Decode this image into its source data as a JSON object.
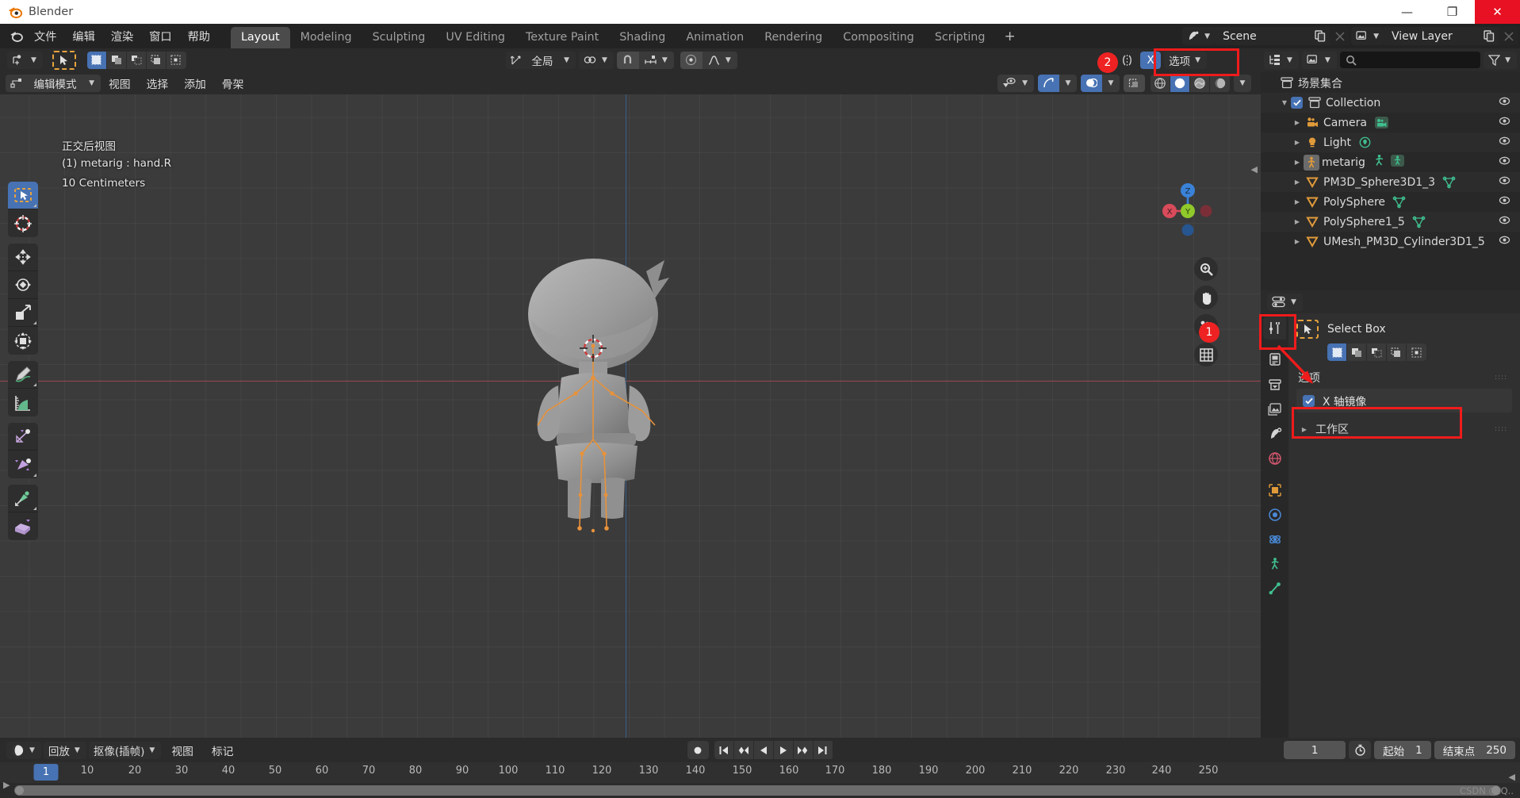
{
  "window": {
    "title": "Blender",
    "logo_icon": "blender-logo-icon",
    "minimize_label": "—",
    "maximize_label": "❐",
    "close_label": "✕"
  },
  "topbar": {
    "menus": [
      "文件",
      "编辑",
      "渲染",
      "窗口",
      "帮助"
    ],
    "workspaces": [
      {
        "label": "Layout",
        "active": true
      },
      {
        "label": "Modeling",
        "active": false
      },
      {
        "label": "Sculpting",
        "active": false
      },
      {
        "label": "UV Editing",
        "active": false
      },
      {
        "label": "Texture Paint",
        "active": false
      },
      {
        "label": "Shading",
        "active": false
      },
      {
        "label": "Animation",
        "active": false
      },
      {
        "label": "Rendering",
        "active": false
      },
      {
        "label": "Compositing",
        "active": false
      },
      {
        "label": "Scripting",
        "active": false
      }
    ],
    "add_workspace_label": "+",
    "scene_name": "Scene",
    "view_layer_name": "View Layer",
    "scene_icon": "scene-icon",
    "view_layer_icon": "view-layer-icon",
    "new_icon": "duplicate-icon",
    "unlink_icon": "x-icon"
  },
  "viewport": {
    "header": {
      "editor_type_icon": "editor-type-icon",
      "select_tool_icon": "select-box-tool-icon",
      "select_modes": [
        "new",
        "extend",
        "subtract",
        "invert",
        "intersect"
      ],
      "select_mode_active": 0,
      "transform_orientation": "全局",
      "pivot_icon": "pivot-point-icon",
      "snap_icon": "snap-magnet-icon",
      "snap_target_icon": "snap-increment-icon",
      "proportional_icon": "proportional-edit-icon",
      "falloff_icon": "falloff-smooth-icon",
      "xray_icon": "x-ray-toggle-icon",
      "mirror_x_label": "X",
      "options_label": "选项"
    },
    "subheader": {
      "mode_icon": "edit-mode-icon",
      "mode": "编辑模式",
      "menus": [
        "视图",
        "选择",
        "添加",
        "骨架"
      ],
      "visibility_icon": "show-hide-icon",
      "gizmo_icon": "gizmo-icon",
      "overlays_icon": "overlays-icon",
      "xray_btn_icon": "toggle-xray-icon",
      "shading_modes": [
        "wireframe",
        "solid",
        "material",
        "rendered"
      ],
      "shading_active": 1
    },
    "overlay_text": [
      "正交后视图",
      "(1) metarig : hand.R",
      "10 Centimeters"
    ],
    "toolbar": [
      {
        "icon": "select-box-tool-icon",
        "active": true,
        "group": 0
      },
      {
        "icon": "cursor-tool-icon",
        "active": false,
        "group": 0
      },
      {
        "icon": "move-tool-icon",
        "active": false,
        "group": 1
      },
      {
        "icon": "rotate-tool-icon",
        "active": false,
        "group": 1
      },
      {
        "icon": "scale-tool-icon",
        "active": false,
        "group": 1
      },
      {
        "icon": "transform-tool-icon",
        "active": false,
        "group": 1
      },
      {
        "icon": "annotate-tool-icon",
        "active": false,
        "group": 2
      },
      {
        "icon": "measure-tool-icon",
        "active": false,
        "group": 2
      },
      {
        "icon": "bone-roll-tool-icon",
        "active": false,
        "group": 3
      },
      {
        "icon": "bone-size-tool-icon",
        "active": false,
        "group": 3
      },
      {
        "icon": "extrude-bone-tool-icon",
        "active": false,
        "group": 4
      },
      {
        "icon": "extrude-region-tool-icon",
        "active": false,
        "group": 4
      }
    ],
    "gizmo": {
      "axes": [
        {
          "label": "Z",
          "color": "#3a82d8",
          "pos": "top"
        },
        {
          "label": "X",
          "color": "#e04b5a",
          "pos": "left"
        },
        {
          "label": "Y",
          "color": "#8fc92a",
          "pos": "center"
        }
      ]
    },
    "nav_buttons": [
      "zoom-icon",
      "pan-hand-icon",
      "camera-view-icon",
      "toggle-ortho-grid-icon"
    ]
  },
  "outliner": {
    "display_mode_icon": "outliner-display-mode-icon",
    "filter_id_icon": "filter-id-icon",
    "search_icon": "search-icon",
    "search_placeholder": "",
    "filter_icon": "funnel-filter-icon",
    "root_label": "场景集合",
    "root_icon": "scene-collection-icon",
    "items": [
      {
        "label": "Collection",
        "icon": "collection-icon",
        "indent": 1,
        "checkbox": true,
        "expanded": true,
        "tags": []
      },
      {
        "label": "Camera",
        "icon": "camera-object-icon",
        "indent": 2,
        "checkbox": false,
        "expanded": false,
        "tags": [
          "camera-data-icon"
        ]
      },
      {
        "label": "Light",
        "icon": "light-object-icon",
        "indent": 2,
        "checkbox": false,
        "expanded": false,
        "tags": [
          "light-data-icon"
        ]
      },
      {
        "label": "metarig",
        "icon": "armature-object-icon",
        "indent": 2,
        "checkbox": false,
        "expanded": false,
        "tags": [
          "pose-icon",
          "armature-data-icon"
        ]
      },
      {
        "label": "PM3D_Sphere3D1_3",
        "icon": "mesh-object-icon",
        "indent": 2,
        "checkbox": false,
        "expanded": false,
        "tags": [
          "mesh-data-icon"
        ]
      },
      {
        "label": "PolySphere",
        "icon": "mesh-object-icon",
        "indent": 2,
        "checkbox": false,
        "expanded": false,
        "tags": [
          "mesh-data-icon"
        ]
      },
      {
        "label": "PolySphere1_5",
        "icon": "mesh-object-icon",
        "indent": 2,
        "checkbox": false,
        "expanded": false,
        "tags": [
          "mesh-data-icon"
        ]
      },
      {
        "label": "UMesh_PM3D_Cylinder3D1_5",
        "icon": "mesh-object-icon",
        "indent": 2,
        "checkbox": false,
        "expanded": false,
        "tags": []
      }
    ],
    "visibility_icon": "eye-icon"
  },
  "properties": {
    "editor_icon": "properties-editor-icon",
    "tabs": [
      {
        "icon": "tool-icon",
        "name": "tool",
        "active": true
      },
      {
        "icon": "render-icon",
        "name": "render",
        "active": false
      },
      {
        "icon": "output-icon",
        "name": "output",
        "active": false
      },
      {
        "icon": "view-layer-props-icon",
        "name": "view-layer",
        "active": false
      },
      {
        "icon": "scene-props-icon",
        "name": "scene",
        "active": false
      },
      {
        "icon": "world-icon",
        "name": "world",
        "active": false
      },
      {
        "icon": "object-props-icon",
        "name": "object",
        "active": false
      },
      {
        "icon": "modifier-icon",
        "name": "modifiers",
        "active": false
      },
      {
        "icon": "physics-icon",
        "name": "physics",
        "active": false
      },
      {
        "icon": "object-constraints-icon",
        "name": "constraints",
        "active": false
      },
      {
        "icon": "bone-icon",
        "name": "bone",
        "active": false
      }
    ],
    "active_tool": {
      "icon": "select-box-tool-icon",
      "name": "Select Box",
      "modes": [
        "set",
        "extend",
        "subtract",
        "difference",
        "intersect"
      ],
      "mode_active": 0
    },
    "options_panel": {
      "title": "选项",
      "mirror_x": {
        "label": "X 轴镜像",
        "checked": true
      }
    },
    "workspace_panel": {
      "title": "工作区",
      "expanded": false
    }
  },
  "timeline": {
    "editor_icon": "timeline-editor-icon",
    "menus": [
      "回放",
      "抠像(插帧)",
      "视图",
      "标记"
    ],
    "record_icon": "record-icon",
    "transport": [
      "jump-to-start-icon",
      "prev-keyframe-icon",
      "play-reverse-icon",
      "play-icon",
      "next-keyframe-icon",
      "jump-to-end-icon"
    ],
    "current_frame": "1",
    "use_preview_icon": "stopwatch-icon",
    "start_label": "起始",
    "start_value": "1",
    "end_label": "结束点",
    "end_value": "250",
    "ticks": [
      "10",
      "20",
      "30",
      "40",
      "50",
      "60",
      "70",
      "80",
      "90",
      "100",
      "110",
      "120",
      "130",
      "140",
      "150",
      "160",
      "170",
      "180",
      "190",
      "200",
      "210",
      "220",
      "230",
      "240",
      "250"
    ],
    "playhead_label": "1"
  },
  "status": {
    "watermark": "CSDN @.Q.."
  },
  "annotations": [
    {
      "number": "1",
      "target": "properties-tool-tab"
    },
    {
      "number": "2",
      "target": "viewport-mirror-x-toggle"
    }
  ],
  "colors": {
    "accent_blue": "#4772b3",
    "annotation_red": "#f01b1b",
    "bone_orange": "#e8923a",
    "axis_x": "#9b4550",
    "axis_z": "#3a6089"
  }
}
